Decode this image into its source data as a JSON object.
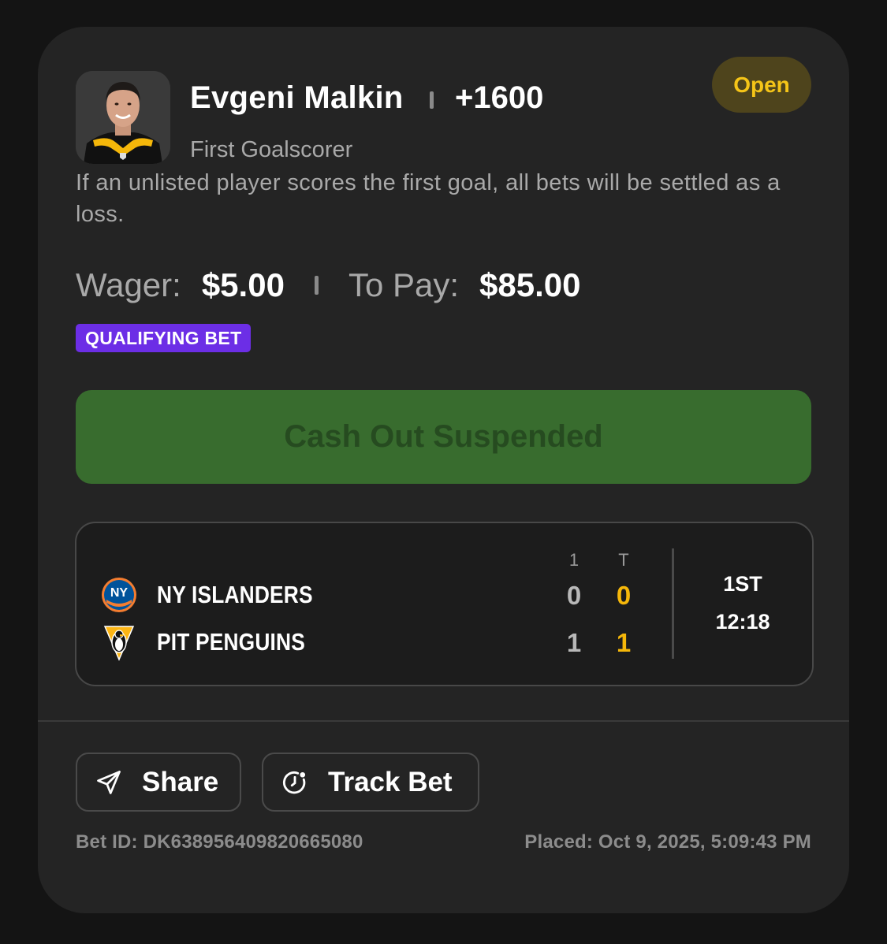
{
  "bet": {
    "player_name": "Evgeni Malkin",
    "odds": "+1600",
    "status": "Open",
    "market": "First Goalscorer",
    "rule_text": "If an unlisted player scores the first goal, all bets will be settled as a loss.",
    "wager_label": "Wager:",
    "wager_value": "$5.00",
    "to_pay_label": "To Pay:",
    "to_pay_value": "$85.00",
    "badge": "QUALIFYING BET",
    "cashout_label": "Cash Out Suspended"
  },
  "scoreboard": {
    "period_header": "1",
    "total_header": "T",
    "teams": [
      {
        "name": "NY ISLANDERS",
        "period_score": "0",
        "total_score": "0",
        "logo": "islanders-logo"
      },
      {
        "name": "PIT PENGUINS",
        "period_score": "1",
        "total_score": "1",
        "logo": "penguins-logo"
      }
    ],
    "period": "1ST",
    "clock": "12:18"
  },
  "actions": {
    "share_label": "Share",
    "share_icon": "send-icon",
    "track_label": "Track Bet",
    "track_icon": "clock-icon"
  },
  "footer": {
    "bet_id": "Bet ID: DK638956409820665080",
    "placed": "Placed: Oct 9, 2025, 5:09:43 PM"
  },
  "colors": {
    "status_text": "#f5c518",
    "badge_bg": "#6c2ee6",
    "cashout_bg": "#386c2e",
    "total_score": "#f5b70a"
  }
}
